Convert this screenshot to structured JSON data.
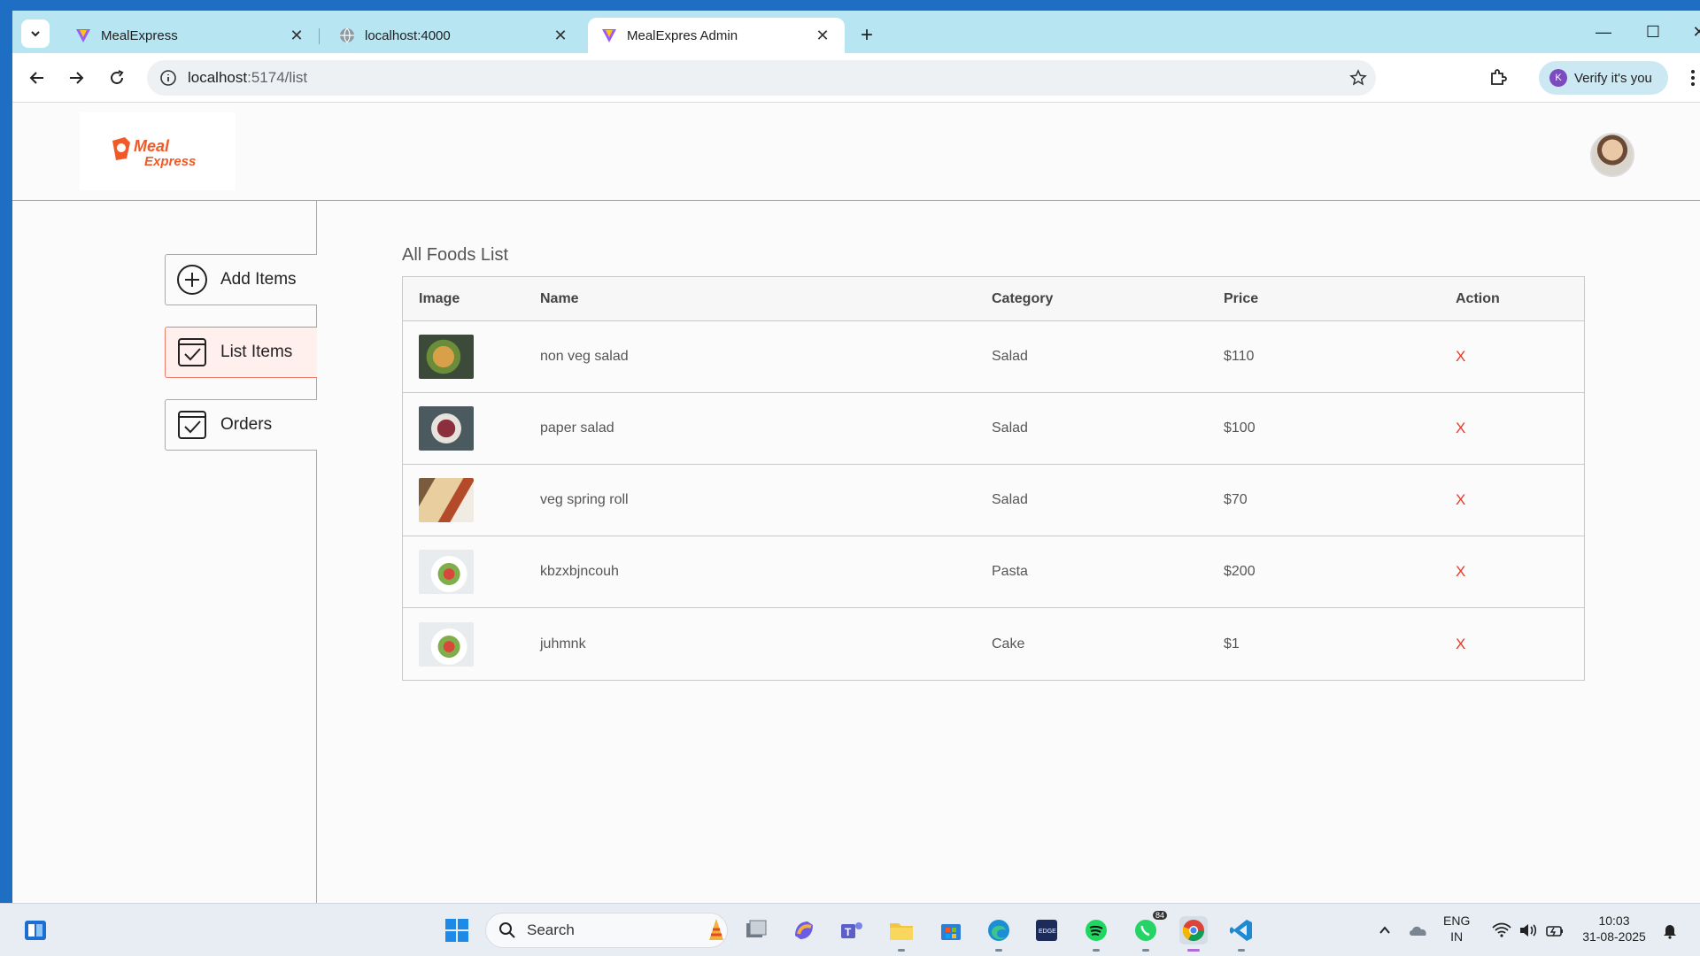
{
  "browser": {
    "tabs": [
      {
        "title": "MealExpress",
        "favicon": "vite-logo-icon",
        "active": false
      },
      {
        "title": "localhost:4000",
        "favicon": "globe-icon",
        "active": false
      },
      {
        "title": "MealExpres Admin",
        "favicon": "vite-logo-icon",
        "active": true
      }
    ],
    "url_host": "localhost",
    "url_path": ":5174/list",
    "verify_label": "Verify it's you",
    "profile_initial": "K"
  },
  "app": {
    "logo_line1": "Meal",
    "logo_line2": "Express",
    "sidebar": [
      {
        "label": "Add Items",
        "icon": "add-circle-icon",
        "active": false
      },
      {
        "label": "List Items",
        "icon": "checkbox-icon",
        "active": true
      },
      {
        "label": "Orders",
        "icon": "checkbox-icon",
        "active": false
      }
    ],
    "page_title": "All Foods List",
    "table": {
      "headers": [
        "Image",
        "Name",
        "Category",
        "Price",
        "Action"
      ],
      "rows": [
        {
          "name": "non veg salad",
          "category": "Salad",
          "price": "$110",
          "action": "X"
        },
        {
          "name": "paper salad",
          "category": "Salad",
          "price": "$100",
          "action": "X"
        },
        {
          "name": "veg spring roll",
          "category": "Salad",
          "price": "$70",
          "action": "X"
        },
        {
          "name": "kbzxbjncouh",
          "category": "Pasta",
          "price": "$200",
          "action": "X"
        },
        {
          "name": "juhmnk",
          "category": "Cake",
          "price": "$1",
          "action": "X"
        }
      ]
    }
  },
  "taskbar": {
    "search_label": "Search",
    "whatsapp_badge": "84",
    "lang_line1": "ENG",
    "lang_line2": "IN",
    "time": "10:03",
    "date": "31-08-2025"
  },
  "colors": {
    "tabstrip": "#b7e5f2",
    "active_sidebar_bg": "#fff0ee",
    "active_sidebar_border": "#f07a6a",
    "remove_red": "#e23b2b",
    "brand_orange": "#f05a28"
  }
}
